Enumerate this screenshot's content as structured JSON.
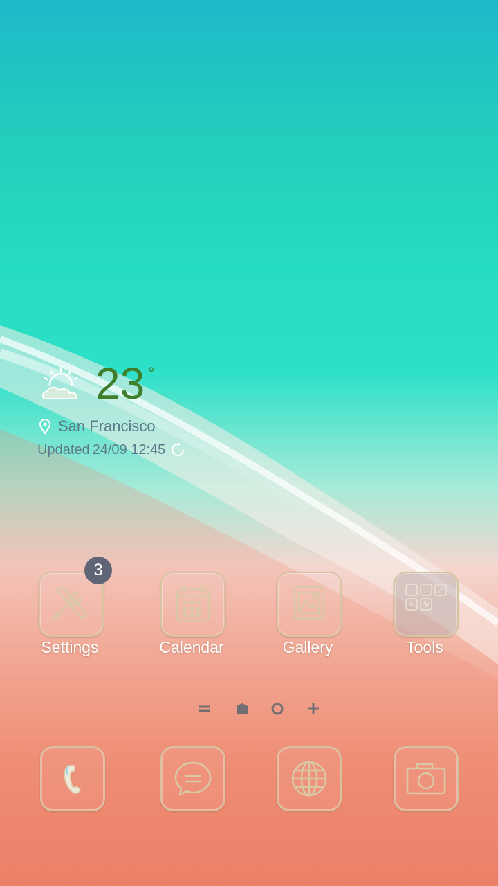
{
  "weather": {
    "temperature": "23",
    "degree_symbol": "°",
    "location": "San Francisco",
    "updated_label": "Updated",
    "updated_time": "24/09 12:45",
    "icon": "partly-sunny-icon"
  },
  "apps": [
    {
      "label": "Settings",
      "icon": "settings-tools-icon",
      "badge": "3"
    },
    {
      "label": "Calendar",
      "icon": "calendar-icon"
    },
    {
      "label": "Gallery",
      "icon": "gallery-icon"
    },
    {
      "label": "Tools",
      "icon": "tools-folder-icon"
    }
  ],
  "page_indicator": [
    "apps-list-icon",
    "home-page-dot",
    "page-dot",
    "add-page-icon"
  ],
  "dock": [
    {
      "icon": "phone-icon"
    },
    {
      "icon": "messages-icon"
    },
    {
      "icon": "internet-icon"
    },
    {
      "icon": "camera-icon"
    }
  ],
  "colors": {
    "temperature": "#3f7f2c",
    "secondary_text": "#5b7a8a",
    "badge": "#5f6477",
    "icon_stroke": "#d6c4a0"
  }
}
